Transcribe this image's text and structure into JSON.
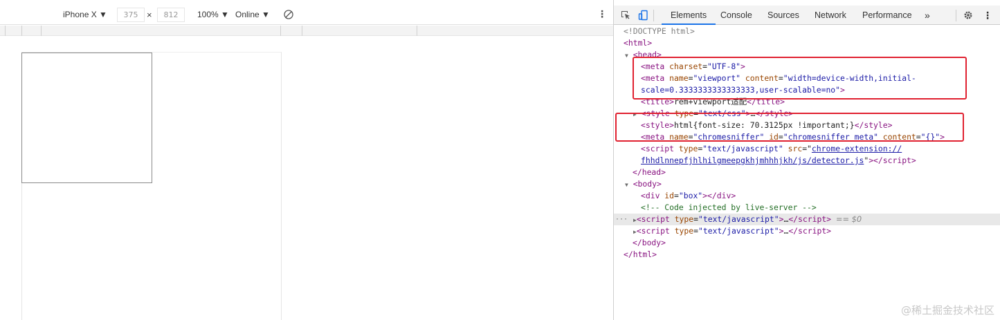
{
  "toolbar": {
    "device": "iPhone X ▼",
    "width": "375",
    "times": "×",
    "height": "812",
    "zoom": "100% ▼",
    "network": "Online ▼",
    "more": "⋮"
  },
  "devtools": {
    "tabs": [
      "Elements",
      "Console",
      "Sources",
      "Network",
      "Performance"
    ],
    "overflow": "»",
    "kebab": "⋮"
  },
  "dom": {
    "doctype": "<!DOCTYPE html>",
    "html_open": "<html>",
    "head_open": "<head>",
    "meta_charset": {
      "tag": "meta",
      "attr": "charset",
      "val": "\"UTF-8\""
    },
    "meta_viewport_a": {
      "tag": "meta",
      "attr1": "name",
      "val1": "\"viewport\"",
      "attr2": "content",
      "val2": "\"width=device-width,initial-"
    },
    "meta_viewport_b": "scale=0.3333333333333333,user-scalable=no\"",
    "title_text": "rem+viewport适配",
    "style_collapsed": {
      "attr": "type",
      "val": "\"text/css\""
    },
    "style_inline": "html{font-size: 70.3125px !important;}",
    "meta_sniffer": {
      "attr1": "name",
      "val1": "\"chromesniffer\"",
      "attr2": "id",
      "val2": "\"chromesniffer_meta\"",
      "attr3": "content",
      "val3": "\"{}\""
    },
    "script_ext_a": {
      "attr1": "type",
      "val1": "\"text/javascript\"",
      "attr2": "src",
      "link": "chrome-extension://"
    },
    "script_ext_b": "fhhdlnnepfjhlhilgmeepgkhjmhhhjkh/js/detector.js",
    "head_close": "</head>",
    "body_open": "<body>",
    "div_box": {
      "attr": "id",
      "val": "\"box\""
    },
    "comment": "<!-- Code injected by live-server -->",
    "script1": {
      "attr": "type",
      "val": "\"text/javascript\""
    },
    "script2": {
      "attr": "type",
      "val": "\"text/javascript\""
    },
    "eq": "== $0",
    "body_close": "</body>",
    "html_close": "</html>"
  },
  "watermark": "@稀土掘金技术社区"
}
